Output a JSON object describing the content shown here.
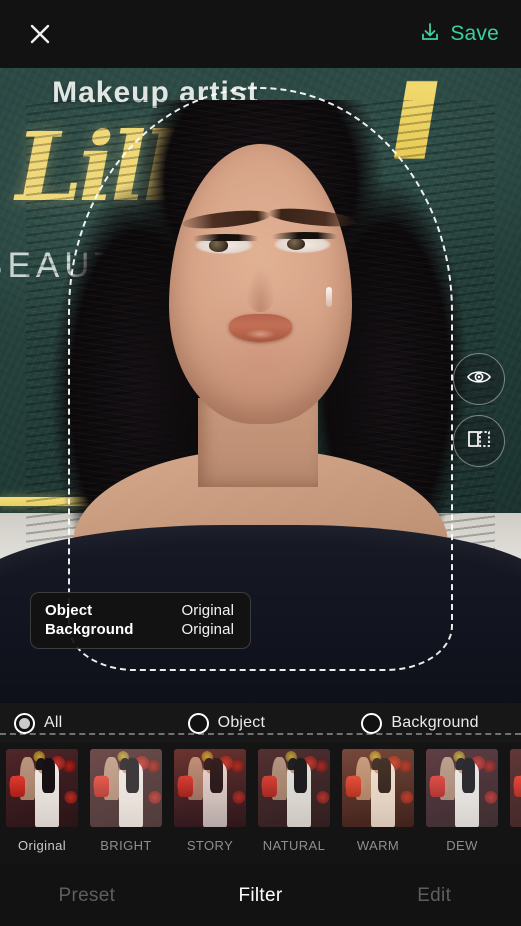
{
  "app": {
    "accent_color": "#3ecfa0",
    "background_color": "#0c0c0c"
  },
  "topbar": {
    "close_icon": "close-icon",
    "save_icon": "download-icon",
    "save_label": "Save"
  },
  "canvas": {
    "background_text": {
      "line1": "Makeup artist",
      "script": "Lilly",
      "line3": "BEAUTY"
    },
    "selection_outline": "dashed-subject-selection",
    "tools": [
      {
        "id": "preview-eye",
        "icon": "eye-icon"
      },
      {
        "id": "compare-split",
        "icon": "split-compare-icon"
      }
    ],
    "info_panel": {
      "rows": [
        {
          "key": "Object",
          "value": "Original"
        },
        {
          "key": "Background",
          "value": "Original"
        }
      ]
    }
  },
  "scope": {
    "selected": "All",
    "options": [
      {
        "label": "All",
        "selected": true
      },
      {
        "label": "Object",
        "selected": false
      },
      {
        "label": "Background",
        "selected": false
      }
    ]
  },
  "filters": {
    "selected": "Original",
    "items": [
      {
        "label": "Original",
        "selected": true
      },
      {
        "label": "BRIGHT",
        "selected": false
      },
      {
        "label": "STORY",
        "selected": false
      },
      {
        "label": "NATURAL",
        "selected": false
      },
      {
        "label": "WARM",
        "selected": false
      },
      {
        "label": "DEW",
        "selected": false
      },
      {
        "label": "",
        "selected": false
      }
    ]
  },
  "tabs": {
    "active": "Filter",
    "items": [
      {
        "label": "Preset",
        "active": false
      },
      {
        "label": "Filter",
        "active": true
      },
      {
        "label": "Edit",
        "active": false
      }
    ]
  }
}
